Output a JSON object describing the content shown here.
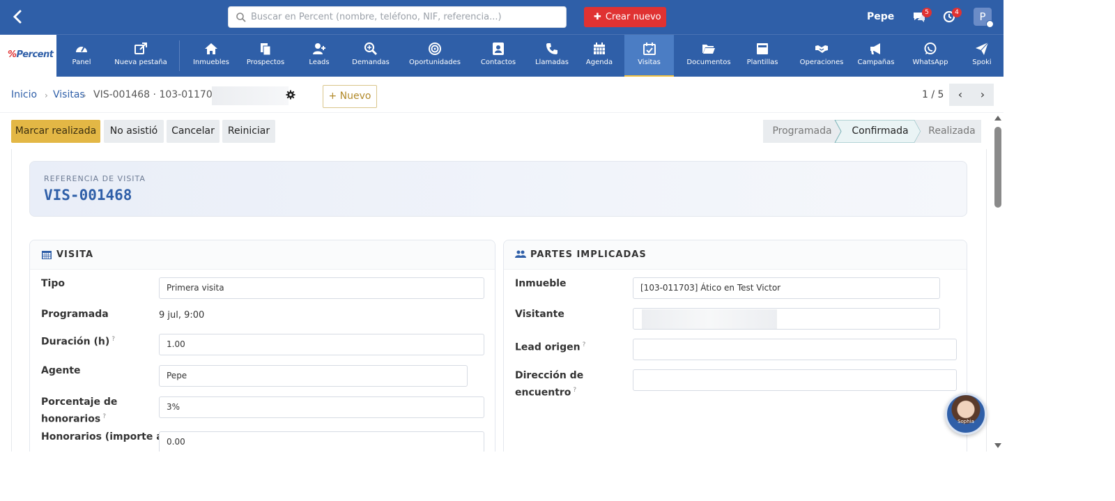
{
  "topbar": {
    "search_placeholder": "Buscar en Percent (nombre, teléfono, NIF, referencia...)",
    "create_label": "Crear nuevo",
    "user": "Pepe",
    "messages_count": "5",
    "activities_count": "4",
    "avatar_initial": "P"
  },
  "logo": {
    "text_p": "%",
    "text_rest": "Percent"
  },
  "nav": [
    {
      "label": "Panel",
      "icon": "dashboard-icon"
    },
    {
      "label": "Nueva pestaña",
      "icon": "external-link-icon"
    },
    {
      "label": "Inmuebles",
      "icon": "home-icon"
    },
    {
      "label": "Prospectos",
      "icon": "documents-icon"
    },
    {
      "label": "Leads",
      "icon": "user-plus-icon"
    },
    {
      "label": "Demandas",
      "icon": "search-plus-icon"
    },
    {
      "label": "Oportunidades",
      "icon": "target-icon"
    },
    {
      "label": "Contactos",
      "icon": "address-book-icon"
    },
    {
      "label": "Llamadas",
      "icon": "phone-icon"
    },
    {
      "label": "Agenda",
      "icon": "calendar-icon"
    },
    {
      "label": "Visitas",
      "icon": "calendar-check-icon",
      "active": true
    },
    {
      "label": "Documentos",
      "icon": "folder-open-icon"
    },
    {
      "label": "Plantillas",
      "icon": "template-icon"
    },
    {
      "label": "Operaciones",
      "icon": "handshake-icon"
    },
    {
      "label": "Campañas",
      "icon": "megaphone-icon"
    },
    {
      "label": "WhatsApp",
      "icon": "whatsapp-icon"
    },
    {
      "label": "Spoki",
      "icon": "paper-plane-icon"
    }
  ],
  "breadcrumb": {
    "home": "Inicio",
    "section": "Visitas",
    "current": "VIS-001468 · 103-011703 · "
  },
  "new_button": "+ Nuevo",
  "pager": {
    "text": "1 / 5",
    "prev": "‹",
    "next": "›"
  },
  "actions": {
    "mark_done": "Marcar realizada",
    "no_show": "No asistió",
    "cancel": "Cancelar",
    "reset": "Reiniciar"
  },
  "stages": [
    "Programada",
    "Confirmada",
    "Realizada"
  ],
  "active_stage": "Confirmada",
  "reference": {
    "label": "REFERENCIA DE VISITA",
    "value": "VIS-001468"
  },
  "visita": {
    "title": "VISITA",
    "tipo_label": "Tipo",
    "tipo_value": "Primera visita",
    "programada_label": "Programada",
    "programada_value": "9 jul, 9:00",
    "duracion_label": "Duración (h)",
    "duracion_value": "1.00",
    "agente_label": "Agente",
    "agente_value": "Pepe",
    "porcentaje_label_1": "Porcentaje de",
    "porcentaje_label_2": "honorarios",
    "porcentaje_value": "3%",
    "honorarios_label": "Honorarios (importe a",
    "honorarios_value": "0.00"
  },
  "partes": {
    "title": "PARTES IMPLICADAS",
    "inmueble_label": "Inmueble",
    "inmueble_value": "[103-011703] Ático en Test Victor",
    "visitante_label": "Visitante",
    "lead_label": "Lead origen",
    "direccion_label_1": "Dirección de",
    "direccion_label_2": "encuentro"
  },
  "help_mark": "?",
  "assistant_name": "Sophia"
}
